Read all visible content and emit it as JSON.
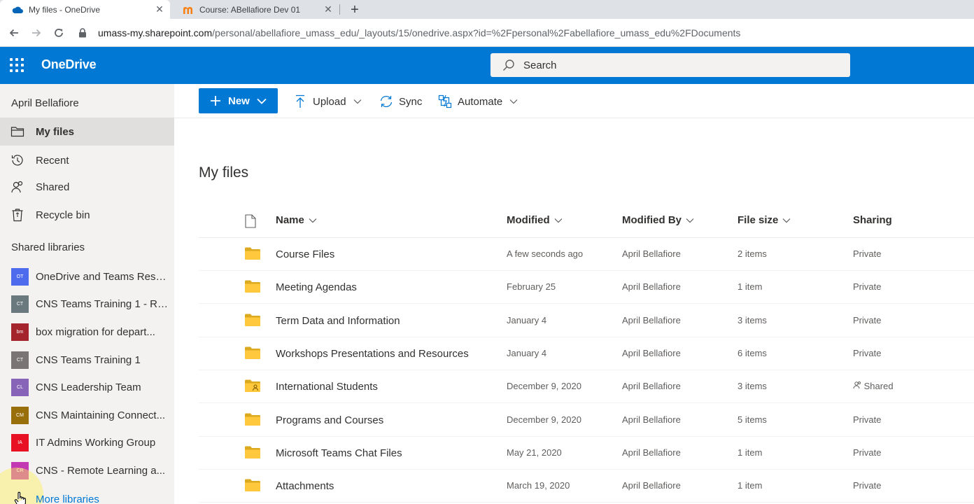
{
  "browser": {
    "tabs": [
      {
        "title": "My files - OneDrive",
        "icon": "onedrive-icon",
        "active": true
      },
      {
        "title": "Course: ABellafiore Dev 01",
        "icon": "moodle-icon",
        "active": false
      }
    ],
    "url_host": "umass-my.sharepoint.com",
    "url_path": "/personal/abellafiore_umass_edu/_layouts/15/onedrive.aspx?id=%2Fpersonal%2Fabellafiore_umass_edu%2FDocuments"
  },
  "suitebar": {
    "brand": "OneDrive",
    "search_placeholder": "Search",
    "color": "#0078d4"
  },
  "leftnav": {
    "user": "April Bellafiore",
    "items": [
      {
        "label": "My files",
        "icon": "folder-icon",
        "selected": true
      },
      {
        "label": "Recent",
        "icon": "history-icon",
        "selected": false
      },
      {
        "label": "Shared",
        "icon": "people-icon",
        "selected": false
      },
      {
        "label": "Recycle bin",
        "icon": "recycle-bin-icon",
        "selected": false
      }
    ],
    "shared_heading": "Shared libraries",
    "libraries": [
      {
        "abbr": "OT",
        "label": "OneDrive and Teams Reso...",
        "color": "#4f6bed"
      },
      {
        "abbr": "CT",
        "label": "CNS Teams Training 1 - Re...",
        "color": "#69797e"
      },
      {
        "abbr": "bm",
        "label": "box migration for depart...",
        "color": "#a4262c"
      },
      {
        "abbr": "CT",
        "label": "CNS Teams Training 1",
        "color": "#7a7574"
      },
      {
        "abbr": "CL",
        "label": "CNS Leadership Team",
        "color": "#8764b8"
      },
      {
        "abbr": "CM",
        "label": "CNS Maintaining Connect...",
        "color": "#986f0b"
      },
      {
        "abbr": "IA",
        "label": "IT Admins Working Group",
        "color": "#e81123"
      },
      {
        "abbr": "CR",
        "label": "CNS - Remote Learning a...",
        "color": "#c239b3"
      }
    ],
    "more_libraries": "More libraries"
  },
  "commandbar": {
    "new": "New",
    "upload": "Upload",
    "sync": "Sync",
    "automate": "Automate"
  },
  "content": {
    "title": "My files",
    "columns": {
      "name": "Name",
      "modified": "Modified",
      "modified_by": "Modified By",
      "file_size": "File size",
      "sharing": "Sharing"
    },
    "rows": [
      {
        "name": "Course Files",
        "modified": "A few seconds ago",
        "modified_by": "April Bellafiore",
        "size": "2 items",
        "sharing": "Private",
        "shared_folder": false
      },
      {
        "name": "Meeting Agendas",
        "modified": "February 25",
        "modified_by": "April Bellafiore",
        "size": "1 item",
        "sharing": "Private",
        "shared_folder": false
      },
      {
        "name": "Term Data and Information",
        "modified": "January 4",
        "modified_by": "April Bellafiore",
        "size": "3 items",
        "sharing": "Private",
        "shared_folder": false
      },
      {
        "name": "Workshops Presentations and Resources",
        "modified": "January 4",
        "modified_by": "April Bellafiore",
        "size": "6 items",
        "sharing": "Private",
        "shared_folder": false
      },
      {
        "name": "International Students",
        "modified": "December 9, 2020",
        "modified_by": "April Bellafiore",
        "size": "3 items",
        "sharing": "Shared",
        "shared_folder": true
      },
      {
        "name": "Programs and Courses",
        "modified": "December 9, 2020",
        "modified_by": "April Bellafiore",
        "size": "5 items",
        "sharing": "Private",
        "shared_folder": false
      },
      {
        "name": "Microsoft Teams Chat Files",
        "modified": "May 21, 2020",
        "modified_by": "April Bellafiore",
        "size": "1 item",
        "sharing": "Private",
        "shared_folder": false
      },
      {
        "name": "Attachments",
        "modified": "March 19, 2020",
        "modified_by": "April Bellafiore",
        "size": "1 item",
        "sharing": "Private",
        "shared_folder": false
      }
    ]
  }
}
